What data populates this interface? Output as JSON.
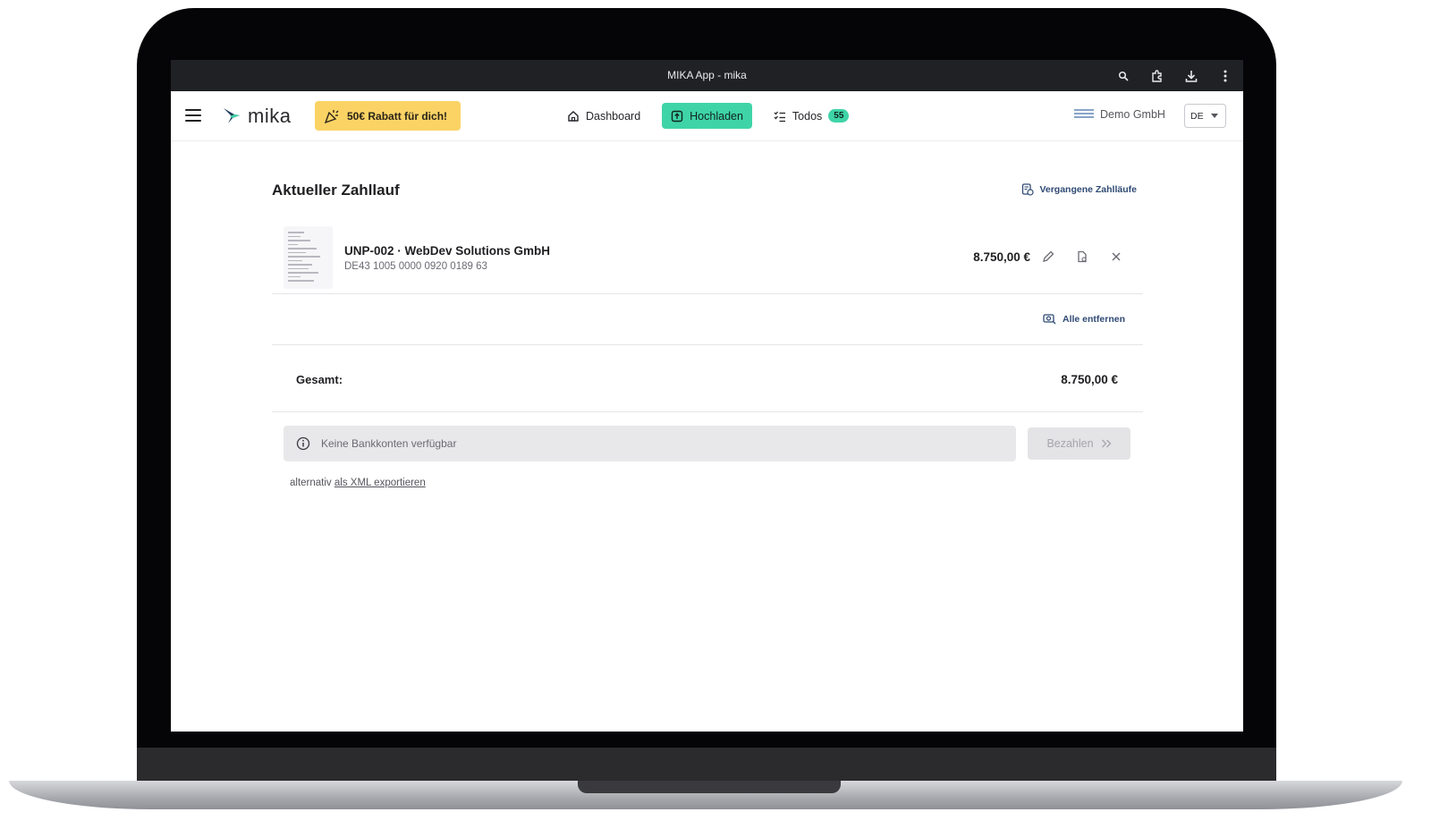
{
  "window": {
    "title": "MIKA App - mika",
    "icons": [
      "zoom-icon",
      "extension-icon",
      "download-icon",
      "more-vert-icon"
    ]
  },
  "header": {
    "logo_text": "mika",
    "promo_label": "50€ Rabatt für dich!",
    "nav": [
      {
        "label": "Dashboard",
        "icon": "home-icon",
        "active": false
      },
      {
        "label": "Hochladen",
        "icon": "upload-icon",
        "active": true
      },
      {
        "label": "Todos",
        "icon": "checklist-icon",
        "active": false,
        "badge": "55"
      }
    ],
    "company": "Demo GmbH",
    "language": "DE",
    "accent_color": "#3fd4a8",
    "promo_color": "#fbd365"
  },
  "main": {
    "heading": "Aktueller Zahllauf",
    "past_runs_label": "Vergangene Zahlläufe",
    "payments": [
      {
        "title": "UNP-002 · WebDev Solutions GmbH",
        "iban": "DE43 1005 0000 0920 0189 63",
        "amount": "8.750,00 €",
        "actions": [
          "edit-icon",
          "document-icon",
          "close-icon"
        ]
      }
    ],
    "remove_all_label": "Alle entfernen",
    "total_label": "Gesamt:",
    "total_value": "8.750,00 €",
    "bank_info": "Keine Bankkonten verfügbar",
    "pay_label": "Bezahlen",
    "alt_prefix": "alternativ",
    "alt_link": "als XML exportieren"
  }
}
